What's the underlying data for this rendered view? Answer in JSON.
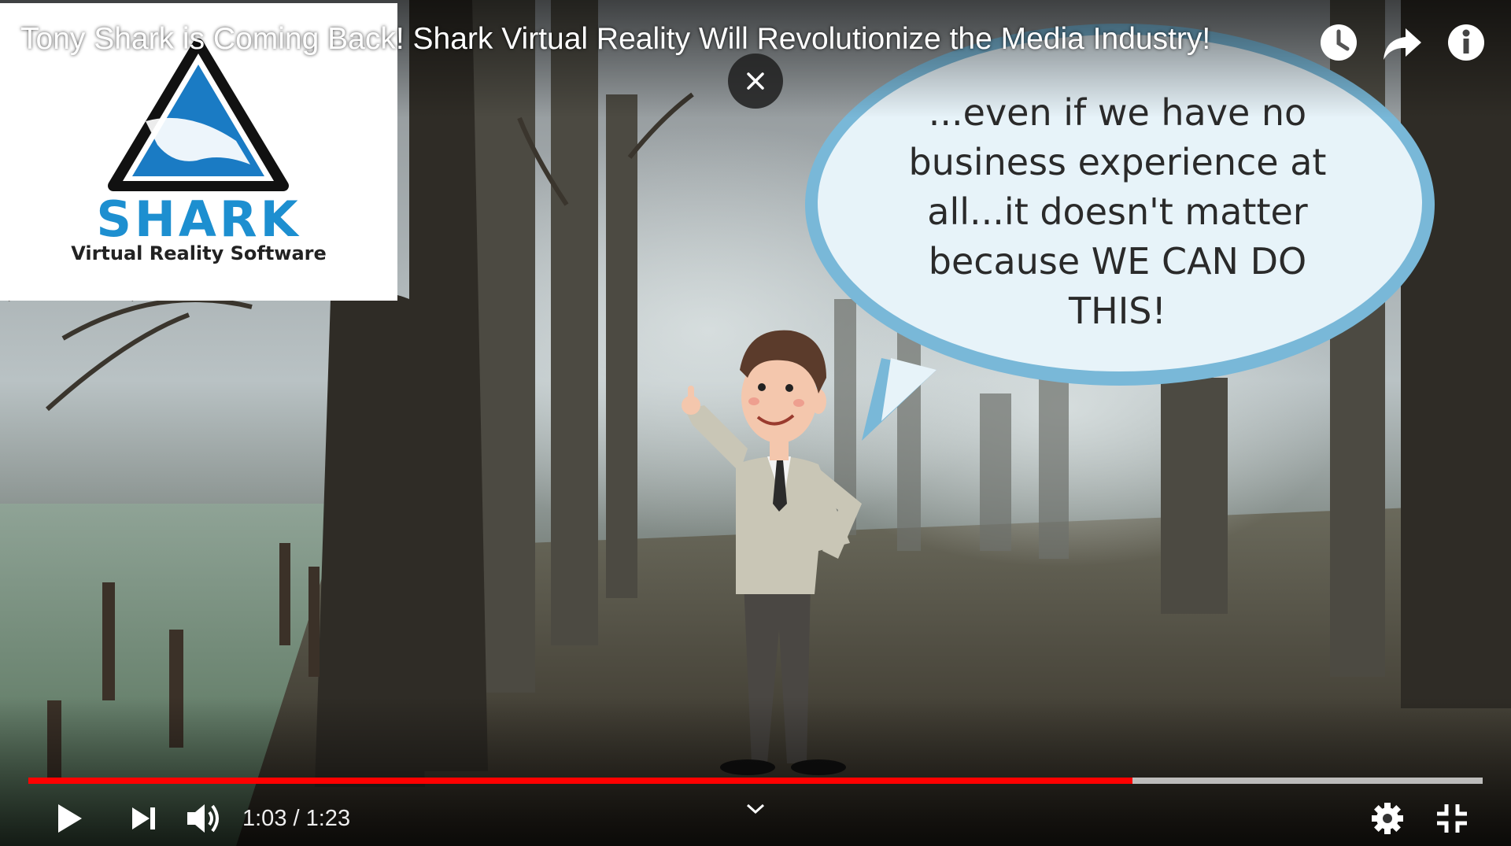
{
  "video": {
    "title": "Tony Shark is Coming Back! Shark Virtual Reality Will Revolutionize the Media Industry!"
  },
  "logo": {
    "brand": "SHARK",
    "tagline": "Virtual Reality Software"
  },
  "speech_bubble": {
    "lines": [
      "...even if we have no",
      "business experience at",
      "all...it doesn't matter",
      "because WE CAN DO",
      "THIS!"
    ]
  },
  "top_actions": {
    "icons": [
      "watch-later-icon",
      "share-icon",
      "info-icon"
    ]
  },
  "player": {
    "current_time": "1:03",
    "duration": "1:23",
    "time_display": "1:03 / 1:23",
    "progress_fraction": 0.759,
    "colors": {
      "played": "#ff0000",
      "controls": "#ffffff"
    }
  }
}
